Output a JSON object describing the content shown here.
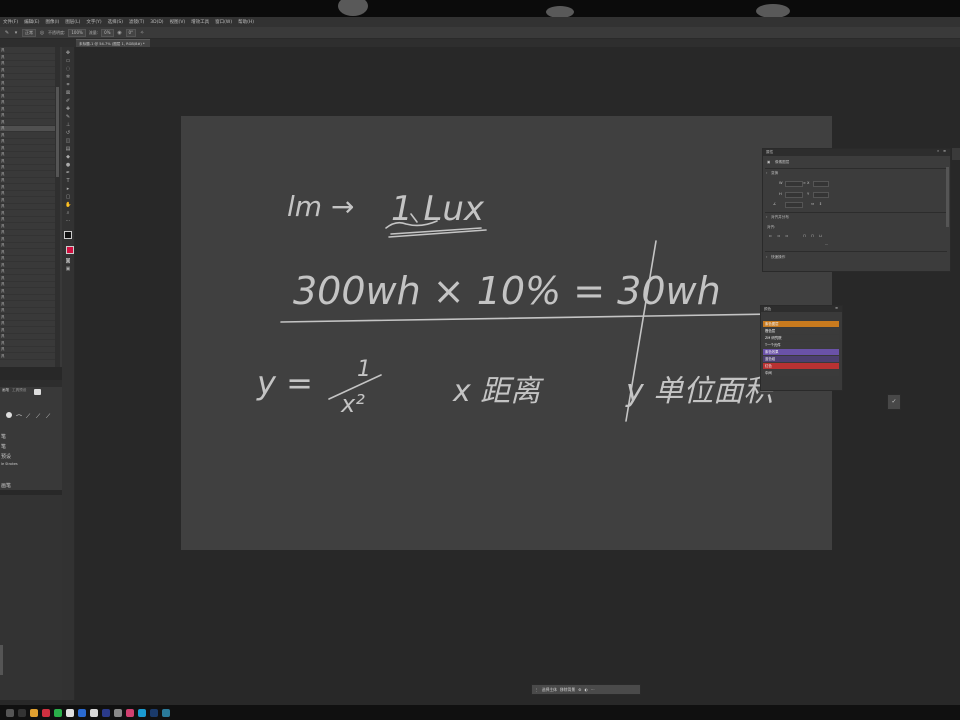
{
  "menubar": {
    "items": [
      "文件(F)",
      "编辑(E)",
      "图像(I)",
      "图层(L)",
      "文字(Y)",
      "选择(S)",
      "滤镜(T)",
      "3D(D)",
      "视图(V)",
      "增效工具",
      "窗口(W)",
      "帮助(H)"
    ]
  },
  "options_bar": {
    "tool_icon": "brush-icon",
    "mode_value": "正常",
    "opacity_label": "不透明度:",
    "opacity_value": "100%",
    "flow_label": "流量:",
    "flow_value": "0%",
    "angle_value": "0°"
  },
  "document_tab": {
    "title": "未标题-1 @ 54.7% (图层 1, RGB/8#) *"
  },
  "left_panel": {
    "rows": [
      "具",
      "具",
      "具",
      "具",
      "具",
      "具",
      "具",
      "具",
      "具",
      "具",
      "具",
      "具",
      "具",
      "具",
      "具",
      "具",
      "具",
      "具",
      "具",
      "具",
      "具",
      "具",
      "具",
      "具",
      "具",
      "具",
      "具",
      "具",
      "具",
      "具",
      "具",
      "具",
      "具",
      "具",
      "具",
      "具",
      "具",
      "具",
      "具",
      "具",
      "具",
      "具",
      "具",
      "具",
      "具",
      "具",
      "具",
      "具"
    ]
  },
  "brush_panel": {
    "tab1": "画笔",
    "tab2": "工具预设",
    "items": [
      "笔",
      "笔",
      "预设",
      "le Strokes",
      "画笔"
    ]
  },
  "canvas": {
    "handwriting": {
      "line1_left": "lm →",
      "line1_right": "1 Lux",
      "line2": "300wh × 10% = 30wh",
      "line3_formula": "y =",
      "line3_num": "1",
      "line3_den": "x²",
      "line3_note1": "x 距离",
      "line3_note2": "y 单位面积"
    }
  },
  "properties_panel": {
    "title": "属性",
    "subtitle": "像素图层",
    "section_transform": "变换",
    "w_label": "W",
    "h_label": "H",
    "x_label": "X",
    "y_label": "Y",
    "angle_value": "0.00°",
    "section_align": "对齐并分布",
    "align_label": "对齐:",
    "section_quick": "快速操作"
  },
  "colors_panel": {
    "title": "颜色",
    "rows": [
      {
        "label": "紫色图层",
        "color": "#c87a1e"
      },
      {
        "label": "橙色层",
        "color": "#3b3b3b"
      },
      {
        "label": "ZM 研究院",
        "color": "#3b3b3b"
      },
      {
        "label": "T一个元件",
        "color": "#3b3b3b"
      },
      {
        "label": "紫色效果",
        "color": "#6a52a8"
      },
      {
        "label": "蓝色组",
        "color": "#4d4070"
      },
      {
        "label": "红色",
        "color": "#b83232"
      },
      {
        "label": "中间",
        "color": "#3b3b3b"
      }
    ]
  },
  "context_bar": {
    "btn1": "选择主体",
    "btn2": "移除背景",
    "more": "···"
  },
  "taskbar": {
    "icons": [
      {
        "name": "start-icon",
        "color": "#555555"
      },
      {
        "name": "search-icon",
        "color": "#333333"
      },
      {
        "name": "files-icon",
        "color": "#e0a030"
      },
      {
        "name": "app-red-icon",
        "color": "#d03040"
      },
      {
        "name": "wechat-icon",
        "color": "#2ab04a"
      },
      {
        "name": "chrome-icon",
        "color": "#e0e0e0"
      },
      {
        "name": "app-blue-icon",
        "color": "#2a6ad0"
      },
      {
        "name": "app-white-icon",
        "color": "#d8d8d8"
      },
      {
        "name": "app-navy-icon",
        "color": "#2a3a8a"
      },
      {
        "name": "app-grey-icon",
        "color": "#888888"
      },
      {
        "name": "app-pink-icon",
        "color": "#d04070"
      },
      {
        "name": "app-cyan-icon",
        "color": "#1a9ad0"
      },
      {
        "name": "photoshop-icon",
        "color": "#1a3a6a"
      },
      {
        "name": "app-teal-icon",
        "color": "#2a7a9a"
      }
    ]
  }
}
